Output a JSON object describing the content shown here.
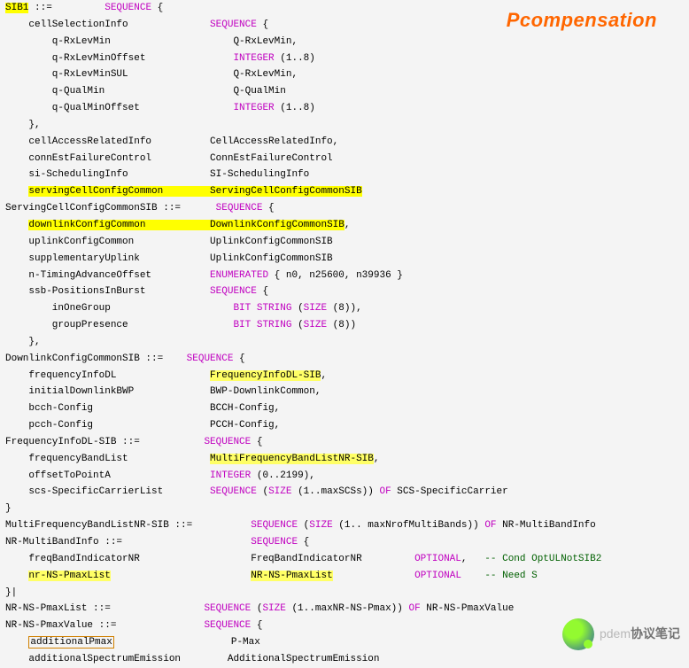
{
  "title": "Pcompensation",
  "watermark": {
    "prefix": "pdem",
    "main": "协议笔记"
  },
  "blocks": [
    {
      "cls": "blk",
      "segs": [
        {
          "t": "SIB1",
          "s": "hl"
        },
        {
          "t": " ::=         "
        },
        {
          "t": "SEQUENCE",
          "s": "kw"
        },
        {
          "t": " {"
        }
      ]
    },
    {
      "cls": "blk",
      "segs": [
        {
          "t": "    cellSelectionInfo              "
        },
        {
          "t": "SEQUENCE",
          "s": "kw"
        },
        {
          "t": " {"
        }
      ]
    },
    {
      "cls": "blk",
      "segs": [
        {
          "t": "        q-RxLevMin                     Q-RxLevMin,"
        }
      ]
    },
    {
      "cls": "blk",
      "segs": [
        {
          "t": "        q-RxLevMinOffset               "
        },
        {
          "t": "INTEGER",
          "s": "kw"
        },
        {
          "t": " (1..8)"
        }
      ]
    },
    {
      "cls": "blk",
      "segs": [
        {
          "t": "        q-RxLevMinSUL                  Q-RxLevMin,"
        }
      ]
    },
    {
      "cls": "blk",
      "segs": [
        {
          "t": "        q-QualMin                      Q-QualMin"
        }
      ]
    },
    {
      "cls": "blk",
      "segs": [
        {
          "t": "        q-QualMinOffset                "
        },
        {
          "t": "INTEGER",
          "s": "kw"
        },
        {
          "t": " (1..8)"
        }
      ]
    },
    {
      "cls": "blk",
      "segs": [
        {
          "t": "    },"
        }
      ]
    },
    {
      "cls": "blk",
      "segs": [
        {
          "t": "    cellAccessRelatedInfo          CellAccessRelatedInfo,"
        }
      ]
    },
    {
      "cls": "blk",
      "segs": [
        {
          "t": "    connEstFailureControl          ConnEstFailureControl"
        }
      ]
    },
    {
      "cls": "blk",
      "segs": [
        {
          "t": "    si-SchedulingInfo              SI-SchedulingInfo"
        }
      ]
    },
    {
      "cls": "blk",
      "segs": [
        {
          "t": "    "
        },
        {
          "t": "servingCellConfigCommon        ",
          "s": "hl"
        },
        {
          "t": "ServingCellConfigCommonSIB",
          "s": "hl"
        }
      ]
    },
    {
      "cls": "blk",
      "segs": [
        {
          "t": "ServingCellConfigCommonSIB ::=      "
        },
        {
          "t": "SEQUENCE",
          "s": "kw"
        },
        {
          "t": " {"
        }
      ]
    },
    {
      "cls": "blk",
      "segs": [
        {
          "t": "    "
        },
        {
          "t": "downlinkConfigCommon           ",
          "s": "hl"
        },
        {
          "t": "DownlinkConfigCommonSIB",
          "s": "hl"
        },
        {
          "t": ","
        }
      ]
    },
    {
      "cls": "blk",
      "segs": [
        {
          "t": "    uplinkConfigCommon             UplinkConfigCommonSIB"
        }
      ]
    },
    {
      "cls": "blk",
      "segs": [
        {
          "t": "    supplementaryUplink            UplinkConfigCommonSIB"
        }
      ]
    },
    {
      "cls": "blk",
      "segs": [
        {
          "t": "    n-TimingAdvanceOffset          "
        },
        {
          "t": "ENUMERATED",
          "s": "kw"
        },
        {
          "t": " { n0, n25600, n39936 }"
        }
      ]
    },
    {
      "cls": "blk",
      "segs": [
        {
          "t": "    ssb-PositionsInBurst           "
        },
        {
          "t": "SEQUENCE",
          "s": "kw"
        },
        {
          "t": " {"
        }
      ]
    },
    {
      "cls": "blk",
      "segs": [
        {
          "t": "        inOneGroup                     "
        },
        {
          "t": "BIT STRING",
          "s": "kw"
        },
        {
          "t": " ("
        },
        {
          "t": "SIZE",
          "s": "kw"
        },
        {
          "t": " (8)),"
        }
      ]
    },
    {
      "cls": "blk",
      "segs": [
        {
          "t": "        groupPresence                  "
        },
        {
          "t": "BIT STRING",
          "s": "kw"
        },
        {
          "t": " ("
        },
        {
          "t": "SIZE",
          "s": "kw"
        },
        {
          "t": " (8))"
        }
      ]
    },
    {
      "cls": "blk",
      "segs": [
        {
          "t": "    },"
        }
      ]
    },
    {
      "cls": "blk",
      "segs": [
        {
          "t": "DownlinkConfigCommonSIB ::=    "
        },
        {
          "t": "SEQUENCE",
          "s": "kw"
        },
        {
          "t": " {"
        }
      ]
    },
    {
      "cls": "blk",
      "segs": [
        {
          "t": "    frequencyInfoDL                "
        },
        {
          "t": "FrequencyInfoDL-SIB",
          "s": "hl2"
        },
        {
          "t": ","
        }
      ]
    },
    {
      "cls": "blk",
      "segs": [
        {
          "t": "    initialDownlinkBWP             BWP-DownlinkCommon,"
        }
      ]
    },
    {
      "cls": "blk",
      "segs": [
        {
          "t": "    bcch-Config                    BCCH-Config,"
        }
      ]
    },
    {
      "cls": "blk",
      "segs": [
        {
          "t": "    pcch-Config                    PCCH-Config,"
        }
      ]
    },
    {
      "cls": "blk",
      "segs": [
        {
          "t": "FrequencyInfoDL-SIB ::=           "
        },
        {
          "t": "SEQUENCE",
          "s": "kw"
        },
        {
          "t": " {"
        }
      ]
    },
    {
      "cls": "blk",
      "segs": [
        {
          "t": "    frequencyBandList              "
        },
        {
          "t": "MultiFrequencyBandListNR-SIB",
          "s": "hl2"
        },
        {
          "t": ","
        }
      ]
    },
    {
      "cls": "blk",
      "segs": [
        {
          "t": "    offsetToPointA                 "
        },
        {
          "t": "INTEGER",
          "s": "kw"
        },
        {
          "t": " (0..2199),"
        }
      ]
    },
    {
      "cls": "blk",
      "segs": [
        {
          "t": "    scs-SpecificCarrierList        "
        },
        {
          "t": "SEQUENCE",
          "s": "kw"
        },
        {
          "t": " ("
        },
        {
          "t": "SIZE",
          "s": "kw"
        },
        {
          "t": " (1..maxSCSs)) "
        },
        {
          "t": "OF",
          "s": "kw"
        },
        {
          "t": " SCS-SpecificCarrier"
        }
      ]
    },
    {
      "cls": "blk",
      "segs": [
        {
          "t": "}"
        }
      ]
    },
    {
      "cls": "blk",
      "segs": [
        {
          "t": "MultiFrequencyBandListNR-SIB ::=          "
        },
        {
          "t": "SEQUENCE",
          "s": "kw"
        },
        {
          "t": " ("
        },
        {
          "t": "SIZE",
          "s": "kw"
        },
        {
          "t": " (1.. maxNrofMultiBands)) "
        },
        {
          "t": "OF",
          "s": "kw"
        },
        {
          "t": " NR-MultiBandInfo"
        }
      ]
    },
    {
      "cls": "blk",
      "segs": [
        {
          "t": "NR-MultiBandInfo ::=                      "
        },
        {
          "t": "SEQUENCE",
          "s": "kw"
        },
        {
          "t": " {"
        }
      ]
    },
    {
      "cls": "blk",
      "segs": [
        {
          "t": "    freqBandIndicatorNR                   FreqBandIndicatorNR         "
        },
        {
          "t": "OPTIONAL",
          "s": "kw"
        },
        {
          "t": ",   "
        },
        {
          "t": "-- Cond OptULNotSIB2",
          "s": "comm"
        }
      ]
    },
    {
      "cls": "blk",
      "segs": [
        {
          "t": "    "
        },
        {
          "t": "nr-NS-PmaxList",
          "s": "hl2"
        },
        {
          "t": "                        "
        },
        {
          "t": "NR-NS-PmaxList",
          "s": "hl2"
        },
        {
          "t": "              "
        },
        {
          "t": "OPTIONAL",
          "s": "kw"
        },
        {
          "t": "    "
        },
        {
          "t": "-- Need S",
          "s": "comm"
        }
      ]
    },
    {
      "cls": "blk",
      "segs": [
        {
          "t": "}|"
        }
      ]
    },
    {
      "cls": "blk",
      "segs": [
        {
          "t": "NR-NS-PmaxList ::=                "
        },
        {
          "t": "SEQUENCE",
          "s": "kw"
        },
        {
          "t": " ("
        },
        {
          "t": "SIZE",
          "s": "kw"
        },
        {
          "t": " (1..maxNR-NS-Pmax)) "
        },
        {
          "t": "OF",
          "s": "kw"
        },
        {
          "t": " NR-NS-PmaxValue"
        }
      ]
    },
    {
      "cls": "blk",
      "segs": [
        {
          "t": "NR-NS-PmaxValue ::=               "
        },
        {
          "t": "SEQUENCE",
          "s": "kw"
        },
        {
          "t": " {"
        }
      ]
    },
    {
      "cls": "blk",
      "segs": [
        {
          "t": "    "
        },
        {
          "t": "additionalPmax",
          "s": "box"
        },
        {
          "t": "                    P-Max"
        }
      ]
    },
    {
      "cls": "blk",
      "segs": [
        {
          "t": "    additionalSpectrumEmission        AdditionalSpectrumEmission"
        }
      ]
    }
  ]
}
